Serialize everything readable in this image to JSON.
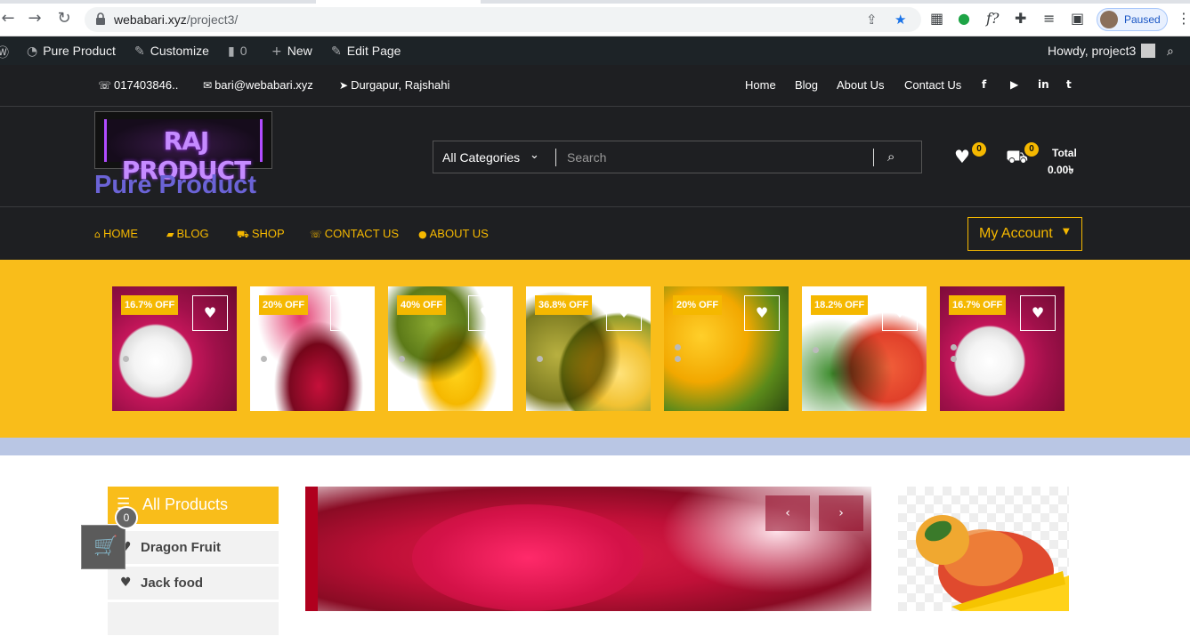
{
  "browser": {
    "url_host": "webabari.xyz",
    "url_path": "/project3/",
    "profile_status": "Paused"
  },
  "admin_bar": {
    "site_name": "Pure Product",
    "customize": "Customize",
    "comments_count": "0",
    "new": "New",
    "edit_page": "Edit Page",
    "howdy": "Howdy, project3"
  },
  "topbar": {
    "phone": "017403846..",
    "email": "bari@webabari.xyz",
    "location": "Durgapur, Rajshahi",
    "links": [
      "Home",
      "Blog",
      "About Us",
      "Contact Us"
    ]
  },
  "header": {
    "logo_text": "RAJ PRODUCT",
    "site_title": "Pure Product",
    "search_category": "All Categories",
    "search_placeholder": "Search",
    "wishlist_count": "0",
    "cart_count": "0",
    "cart_total_label": "Total",
    "cart_total_value": "0.00৳"
  },
  "main_nav": {
    "items": [
      "HOME",
      "BLOG",
      "SHOP",
      "CONTACT US",
      "ABOUT US"
    ],
    "account": "My Account"
  },
  "banner": {
    "products": [
      {
        "discount": "16.7% OFF",
        "fruit": "dragon-fruit"
      },
      {
        "discount": "20% OFF",
        "fruit": "dragon-fruit-red"
      },
      {
        "discount": "40% OFF",
        "fruit": "jackfruit"
      },
      {
        "discount": "36.8% OFF",
        "fruit": "jackfruit-cut"
      },
      {
        "discount": "20% OFF",
        "fruit": "mango-pile"
      },
      {
        "discount": "18.2% OFF",
        "fruit": "mango"
      },
      {
        "discount": "16.7% OFF",
        "fruit": "dragon-fruit"
      }
    ]
  },
  "sidebar": {
    "title": "All Products",
    "items": [
      "Dragon Fruit",
      "Jack food"
    ]
  },
  "floating_cart": {
    "count": "0"
  },
  "colors": {
    "accent": "#f9bd1a",
    "dark": "#1e1f22",
    "title_purple": "#6b63d6"
  }
}
